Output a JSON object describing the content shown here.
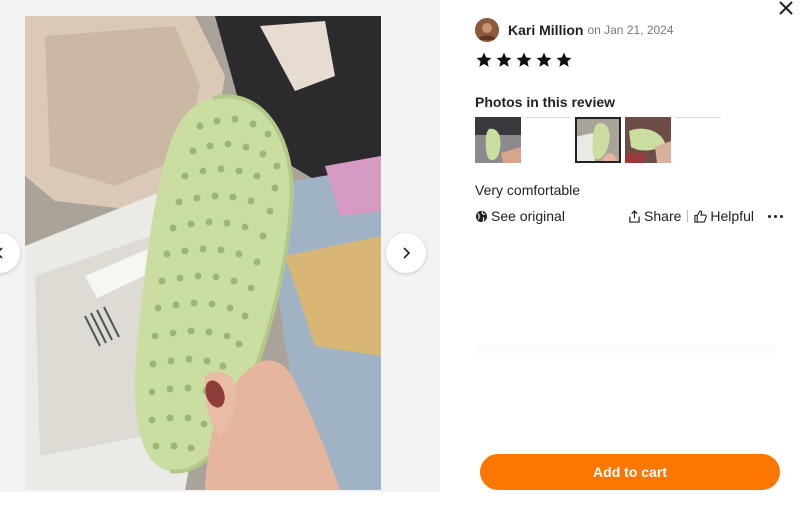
{
  "review": {
    "author_name": "Kari Million",
    "date": "on Jan 21, 2024",
    "rating": 5,
    "photos_title": "Photos in this review",
    "text": "Very comfortable",
    "see_original_label": "See original",
    "share_label": "Share",
    "helpful_label": "Helpful"
  },
  "cart": {
    "add_to_cart_label": "Add to cart"
  },
  "colors": {
    "accent": "#fb7701",
    "star": "#111111",
    "insole": "#c9dea0"
  },
  "icons": {
    "close": "close-icon",
    "prev": "chevron-left-icon",
    "next": "chevron-right-icon",
    "see_original": "globe-icon",
    "share": "share-icon",
    "helpful": "thumbs-up-icon",
    "more": "more-icon"
  }
}
